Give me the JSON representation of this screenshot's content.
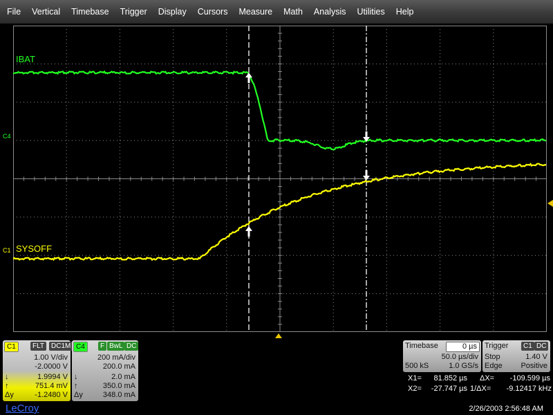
{
  "menu": [
    "File",
    "Vertical",
    "Timebase",
    "Trigger",
    "Display",
    "Cursors",
    "Measure",
    "Math",
    "Analysis",
    "Utilities",
    "Help"
  ],
  "colors": {
    "ch1": "#ffff00",
    "ch4": "#22ff22",
    "grid": "#8c8c8c",
    "trigger_marker": "#e8c400"
  },
  "traces": {
    "ibat": {
      "label": "IBAT",
      "channel_tag": "C4"
    },
    "sysoff": {
      "label": "SYSOFF",
      "channel_tag": "C1"
    }
  },
  "ch1": {
    "tag": "C1",
    "flags": [
      "FLT",
      "DC1M"
    ],
    "vdiv": "1.00 V/div",
    "offset": "-2.0000 V",
    "rows": [
      {
        "sym": "↓",
        "val": "1.9994 V"
      },
      {
        "sym": "↑",
        "val": "751.4 mV"
      },
      {
        "sym": "Δy",
        "val": "-1.2480 V"
      }
    ]
  },
  "ch4": {
    "tag": "C4",
    "flags": [
      "F",
      "BwL",
      "DC"
    ],
    "vdiv": "200 mA/div",
    "offset": "200.0 mA",
    "rows": [
      {
        "sym": "↓",
        "val": "2.0 mA"
      },
      {
        "sym": "↑",
        "val": "350.0 mA"
      },
      {
        "sym": "Δy",
        "val": "348.0 mA"
      }
    ]
  },
  "timebase": {
    "title": "Timebase",
    "delay": "0 µs",
    "per_div": "50.0 µs/div",
    "samples": "500 kS",
    "rate": "1.0 GS/s"
  },
  "trigger": {
    "title": "Trigger",
    "channel": "C1",
    "coupling": "DC",
    "mode": "Stop",
    "level": "1.40 V",
    "type": "Edge",
    "slope": "Positive"
  },
  "cursors": {
    "x1_label": "X1=",
    "x1": "81.852 µs",
    "dx_label": "ΔX=",
    "dx": "-109.599 µs",
    "x2_label": "X2=",
    "x2": "-27.747 µs",
    "inv_label": "1/ΔX=",
    "inv": "-9.12417 kHz"
  },
  "brand": "LeCroy",
  "datetime": "2/26/2003 2:56:48 AM"
}
